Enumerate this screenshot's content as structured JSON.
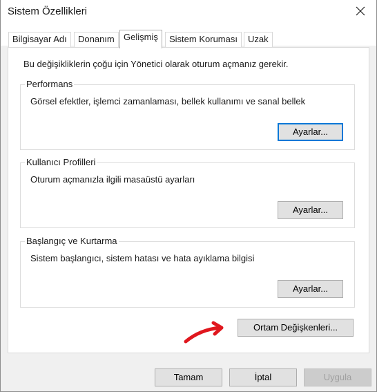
{
  "window": {
    "title": "Sistem Özellikleri"
  },
  "tabs": [
    {
      "label": "Bilgisayar Adı"
    },
    {
      "label": "Donanım"
    },
    {
      "label": "Gelişmiş"
    },
    {
      "label": "Sistem Koruması"
    },
    {
      "label": "Uzak"
    }
  ],
  "active_tab": "Gelişmiş",
  "main": {
    "notice": "Bu değişikliklerin çoğu için Yönetici olarak oturum açmanız gerekir.",
    "groups": [
      {
        "title": "Performans",
        "description": "Görsel efektler, işlemci zamanlaması, bellek kullanımı ve sanal bellek",
        "button": "Ayarlar..."
      },
      {
        "title": "Kullanıcı Profilleri",
        "description": "Oturum açmanızla ilgili masaüstü ayarları",
        "button": "Ayarlar..."
      },
      {
        "title": "Başlangıç ve Kurtarma",
        "description": "Sistem başlangıcı, sistem hatası ve hata ayıklama bilgisi",
        "button": "Ayarlar..."
      }
    ],
    "env_button": "Ortam Değişkenleri..."
  },
  "footer": {
    "ok": "Tamam",
    "cancel": "İptal",
    "apply": "Uygula"
  },
  "colors": {
    "focus_border": "#0078d7",
    "annotation_arrow": "#e0171e"
  }
}
